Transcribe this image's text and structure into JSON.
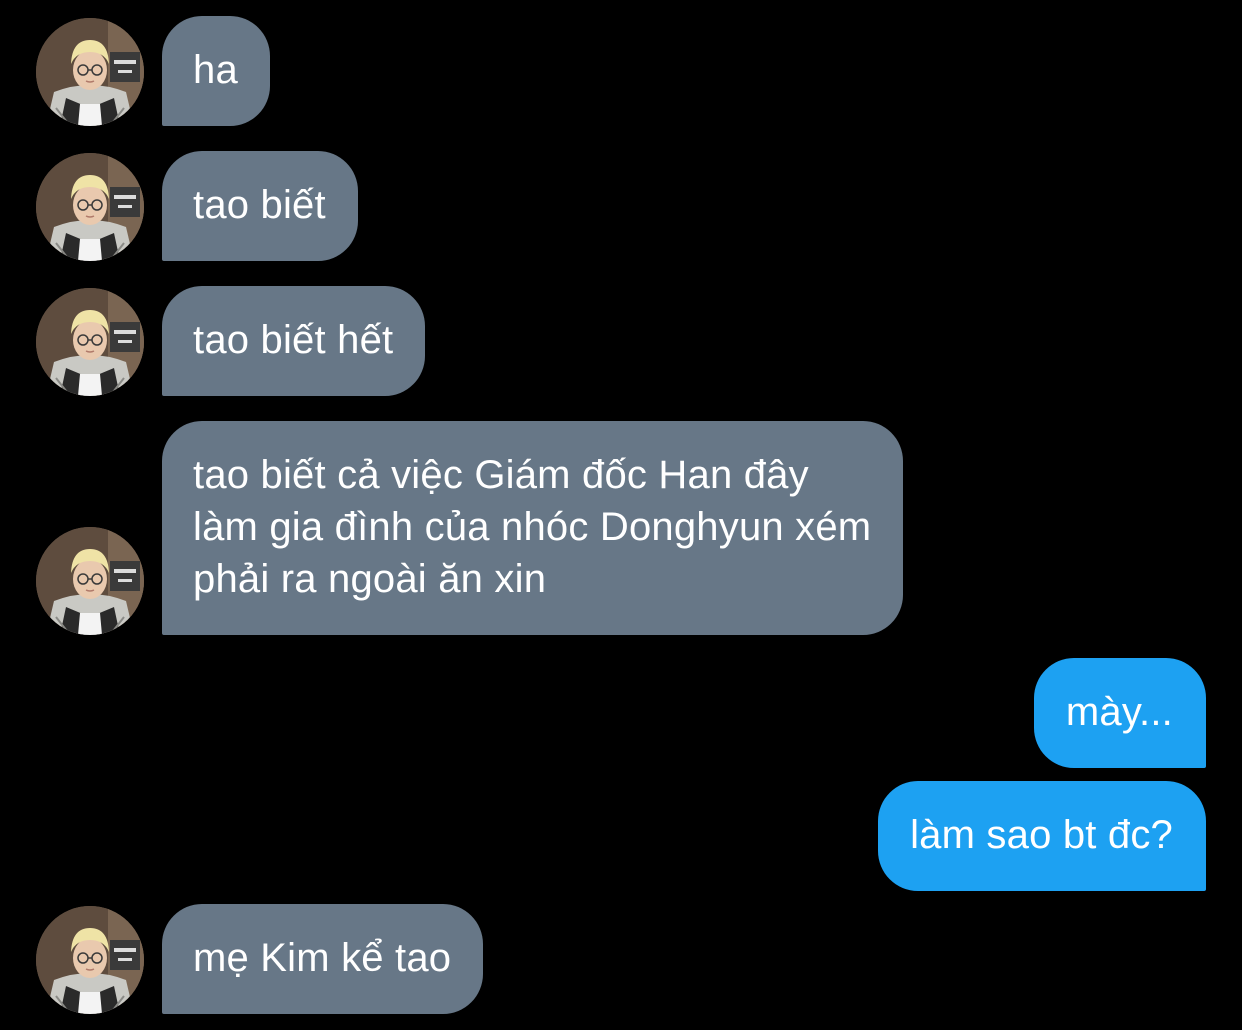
{
  "conversation": {
    "messages": [
      {
        "direction": "incoming",
        "text": "ha",
        "avatar": "avatar-blond-boy-glasses"
      },
      {
        "direction": "incoming",
        "text": "tao biết",
        "avatar": "avatar-blond-boy-glasses"
      },
      {
        "direction": "incoming",
        "text": "tao biết hết",
        "avatar": "avatar-blond-boy-glasses"
      },
      {
        "direction": "incoming",
        "text": "tao biết cả việc Giám đốc Han đây\nlàm gia đình của nhóc Donghyun xém\nphải ra ngoài ăn xin",
        "avatar": "avatar-blond-boy-glasses"
      },
      {
        "direction": "outgoing",
        "text": "mày..."
      },
      {
        "direction": "outgoing",
        "text": "làm sao bt đc?"
      },
      {
        "direction": "incoming",
        "text": "mẹ Kim kể tao",
        "avatar": "avatar-blond-boy-glasses"
      }
    ]
  },
  "colors": {
    "background": "#000000",
    "incoming_bubble": "#677787",
    "outgoing_bubble": "#1da1f2",
    "text": "#ffffff"
  }
}
